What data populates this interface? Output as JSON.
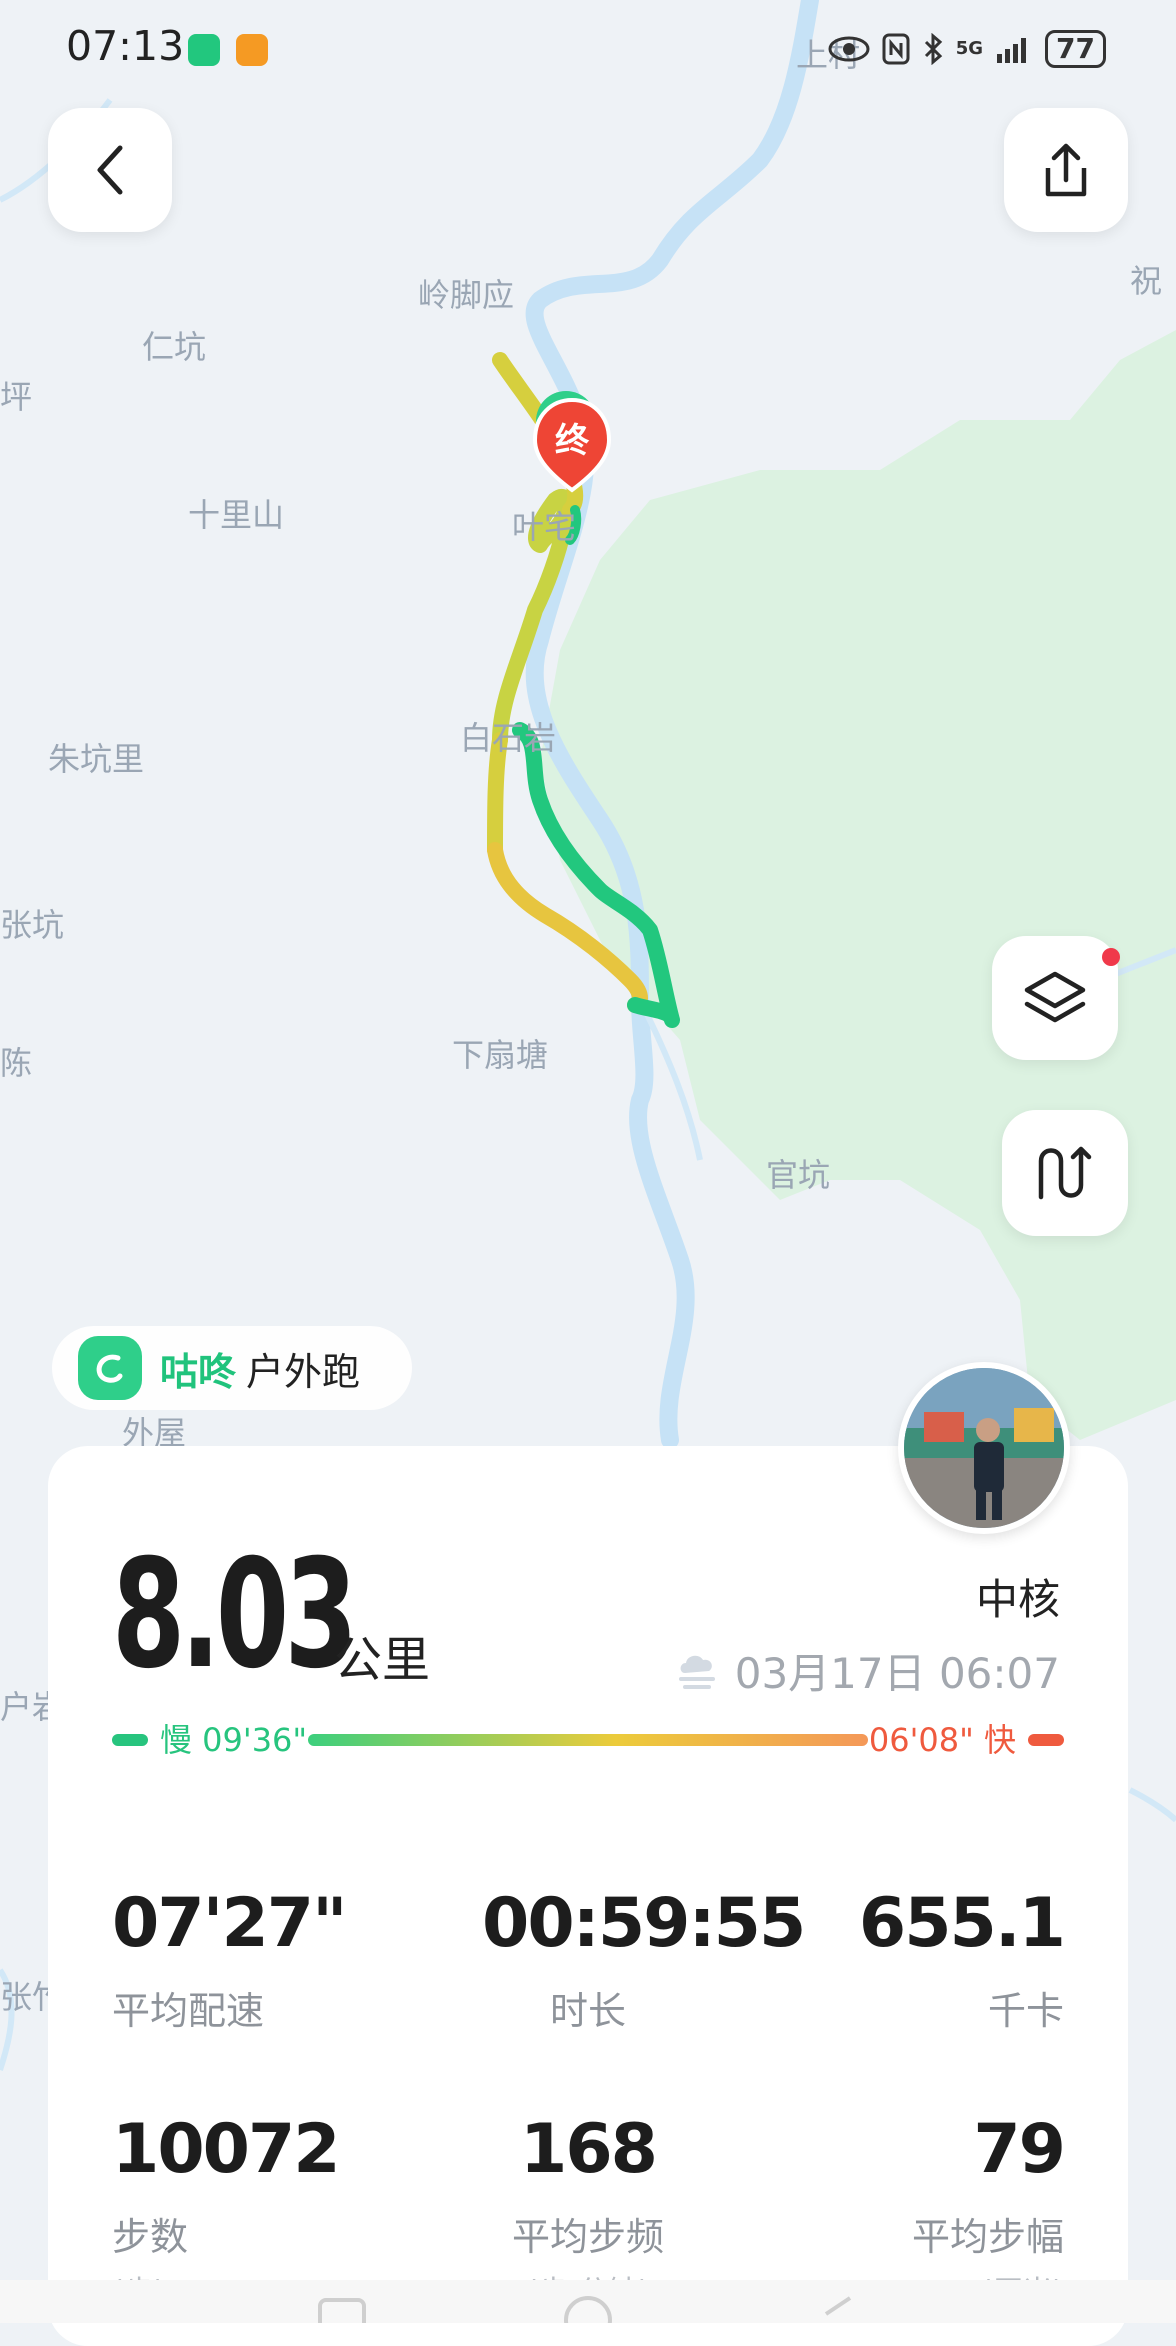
{
  "status_bar": {
    "time": "07:13",
    "signal": "5G",
    "battery": "77",
    "icons": [
      "wechat-icon",
      "video-app-icon",
      "eye-icon",
      "nfc-icon",
      "bluetooth-icon",
      "signal-icon",
      "battery-icon"
    ]
  },
  "map": {
    "labels": [
      "岭脚应",
      "仁坑",
      "坪",
      "十里山",
      "叶宅",
      "朱坑里",
      "白石岩",
      "张坑",
      "陈",
      "下扇塘",
      "官坑",
      "外屋",
      "祝",
      "上村",
      "户岩",
      "张竹"
    ],
    "end_marker": "终",
    "colors": {
      "water": "#c6e2f6",
      "forest": "#dcf2e1",
      "route_fast": "#22c77e",
      "route_mid": "#e9cf3a",
      "route_slow": "#f5a65b",
      "end_marker": "#ee4535"
    }
  },
  "controls": {
    "back": "chevron-left-icon",
    "share": "share-icon",
    "layers": "layers-icon",
    "route_toggle": "route-icon"
  },
  "brand": {
    "name": "咕咚",
    "sport": "户外跑"
  },
  "summary": {
    "distance": "8.03",
    "distance_unit": "公里",
    "user_name": "中核",
    "datetime": "03月17日 06:07",
    "weather_icon": "cloudy-icon"
  },
  "pace_legend": {
    "slow_label": "慢 09'36\"",
    "fast_label": "06'08\" 快",
    "slow_color": "#27c47e",
    "fast_color": "#ef5a3e"
  },
  "stats": [
    {
      "value": "07'27\"",
      "label": "平均配速",
      "sub": ""
    },
    {
      "value": "00:59:55",
      "label": "时长",
      "sub": ""
    },
    {
      "value": "655.1",
      "label": "千卡",
      "sub": ""
    },
    {
      "value": "10072",
      "label": "步数",
      "sub": "(步)"
    },
    {
      "value": "168",
      "label": "平均步频",
      "sub": "(步/分钟)"
    },
    {
      "value": "79",
      "label": "平均步幅",
      "sub": "(厘米)"
    }
  ]
}
